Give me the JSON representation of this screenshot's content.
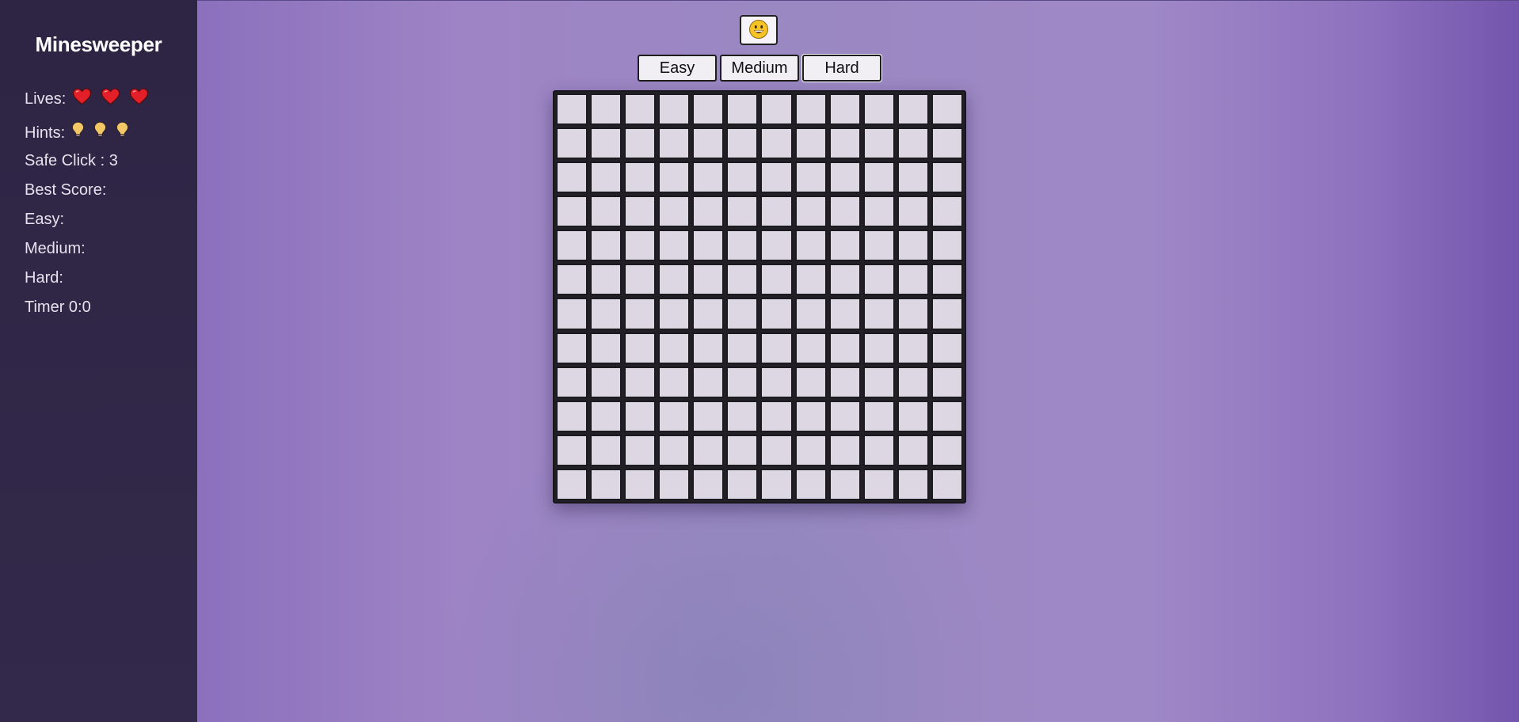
{
  "sidebar": {
    "title": "Minesweeper",
    "lives_label": "Lives:",
    "lives_count": 3,
    "lives_icon": "heart-icon",
    "hints_label": "Hints:",
    "hints_count": 3,
    "hints_icon": "lightbulb-icon",
    "safe_click": "Safe Click : 3",
    "best_score_label": "Best Score:",
    "easy_label": "Easy:",
    "medium_label": "Medium:",
    "hard_label": "Hard:",
    "timer": "Timer 0:0"
  },
  "game": {
    "face_icon": "smiley-face-icon",
    "face_glyph": "😀",
    "levels": [
      "Easy",
      "Medium",
      "Hard"
    ],
    "selected_level": "Hard",
    "rows": 12,
    "cols": 12
  },
  "colors": {
    "sidebar_bg": "#2e2444",
    "page_bg": "#9a86c4",
    "cell_bg": "#dcd7e2",
    "heart": "#e3202a",
    "bulb": "#f2c867"
  }
}
